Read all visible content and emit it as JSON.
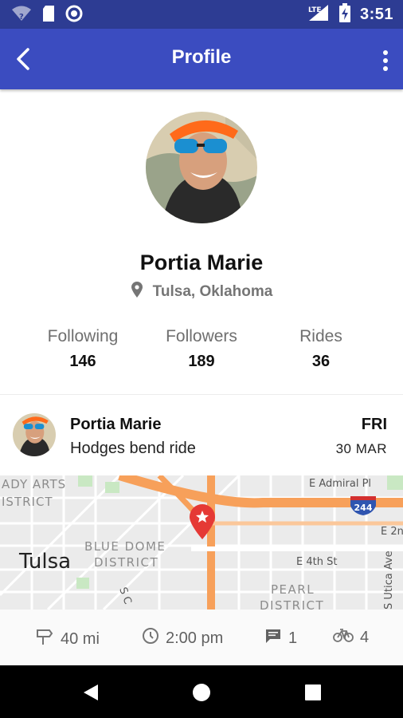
{
  "status_bar": {
    "time": "3:51",
    "network": "LTE",
    "icons": [
      "wifi-question-icon",
      "sd-card-icon",
      "sync-circle-icon",
      "signal-icon",
      "battery-charging-icon"
    ]
  },
  "app_bar": {
    "title": "Profile",
    "back_icon": "back-arrow-icon",
    "menu_icon": "more-vert-icon"
  },
  "profile": {
    "name": "Portia Marie",
    "location": "Tulsa, Oklahoma",
    "location_icon": "map-pin-icon",
    "stats": [
      {
        "label": "Following",
        "value": "146"
      },
      {
        "label": "Followers",
        "value": "189"
      },
      {
        "label": "Rides",
        "value": "36"
      }
    ]
  },
  "ride": {
    "user": "Portia Marie",
    "name": "Hodges bend ride",
    "day": "FRI",
    "date": "30 MAR",
    "map_labels": {
      "city": "Tulsa",
      "district1": "BLUE DOME",
      "district2": "DISTRICT",
      "arts1": "ADY ARTS",
      "arts2": "ISTRICT",
      "pearl1": "PEARL",
      "pearl2": "DISTRICT",
      "admiral": "E Admiral Pl",
      "fourth": "E 4th St",
      "e2": "E 2n",
      "utica": "S Utica Ave",
      "sc": "S C",
      "highway": "244"
    },
    "stats": {
      "distance": "40 mi",
      "time": "2:00 pm",
      "comments": "1",
      "riders": "4"
    }
  },
  "colors": {
    "status_bar": "#2d3c93",
    "app_bar": "#3b4cc0",
    "marker": "#e53935",
    "road": "#f7a05a"
  }
}
